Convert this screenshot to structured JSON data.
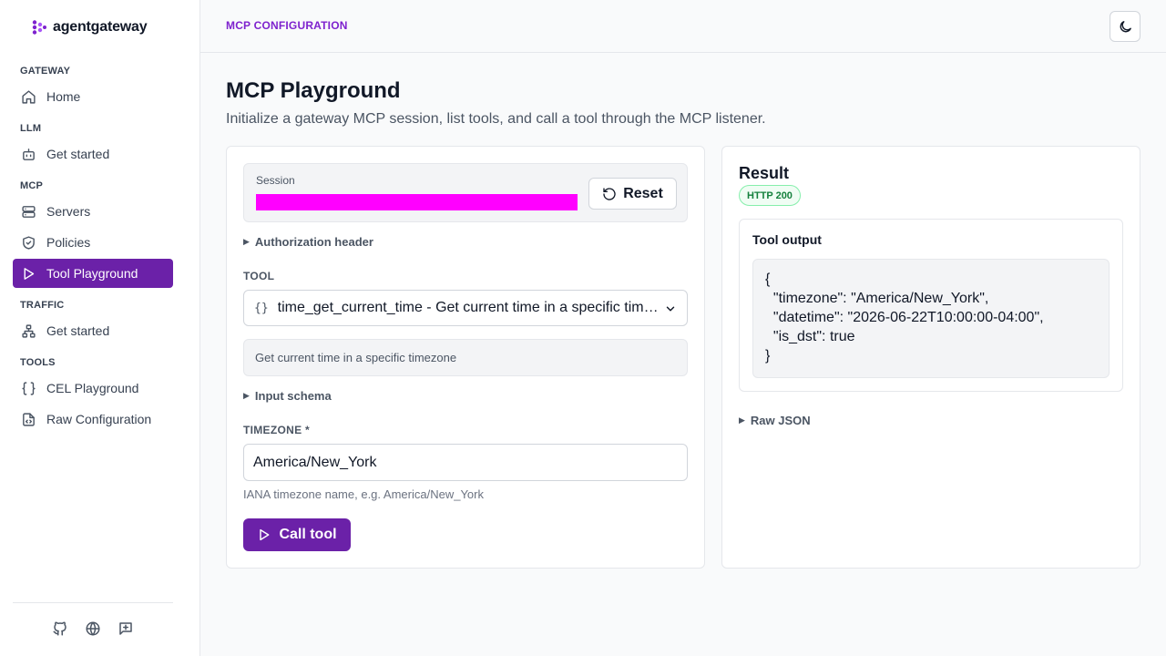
{
  "brand": {
    "name": "agentgateway"
  },
  "sidebar": {
    "sections": [
      {
        "label": "GATEWAY"
      },
      {
        "label": "LLM"
      },
      {
        "label": "MCP"
      },
      {
        "label": "TRAFFIC"
      },
      {
        "label": "TOOLS"
      }
    ],
    "items": [
      {
        "label": "Home",
        "icon": "home-icon"
      },
      {
        "label": "Get started",
        "icon": "bot-icon"
      },
      {
        "label": "Servers",
        "icon": "server-icon"
      },
      {
        "label": "Policies",
        "icon": "shield-icon"
      },
      {
        "label": "Tool Playground",
        "icon": "play-icon",
        "active": true
      },
      {
        "label": "Get started",
        "icon": "network-icon"
      },
      {
        "label": "CEL Playground",
        "icon": "braces-icon"
      },
      {
        "label": "Raw Configuration",
        "icon": "file-code-icon"
      }
    ],
    "footer_icons": [
      "github-icon",
      "globe-icon",
      "feedback-icon"
    ]
  },
  "header": {
    "breadcrumb": "MCP CONFIGURATION",
    "theme_icon": "moon-icon"
  },
  "page": {
    "title": "MCP Playground",
    "subtitle": "Initialize a gateway MCP session, list tools, and call a tool through the MCP listener."
  },
  "left_panel": {
    "session_label": "Session",
    "reset_label": "Reset",
    "auth_header_label": "Authorization header",
    "tool_label": "TOOL",
    "tool_prefix": "{}",
    "tool_selected": "time_get_current_time - Get current time in a specific timezone",
    "tool_description": "Get current time in a specific timezone",
    "input_schema_label": "Input schema",
    "timezone_label": "TIMEZONE *",
    "timezone_value": "America/New_York",
    "timezone_hint": "IANA timezone name, e.g. America/New_York",
    "call_label": "Call tool"
  },
  "right_panel": {
    "title": "Result",
    "status_badge": "HTTP 200",
    "output_title": "Tool output",
    "output_text": "{\n  \"timezone\": \"America/New_York\",\n  \"datetime\": \"2026-06-22T10:00:00-04:00\",\n  \"is_dst\": true\n}",
    "raw_json_label": "Raw JSON"
  },
  "colors": {
    "accent": "#6b21a8",
    "breadcrumb": "#7e22ce",
    "success": "#15803d",
    "redaction": "#ff00ff"
  }
}
